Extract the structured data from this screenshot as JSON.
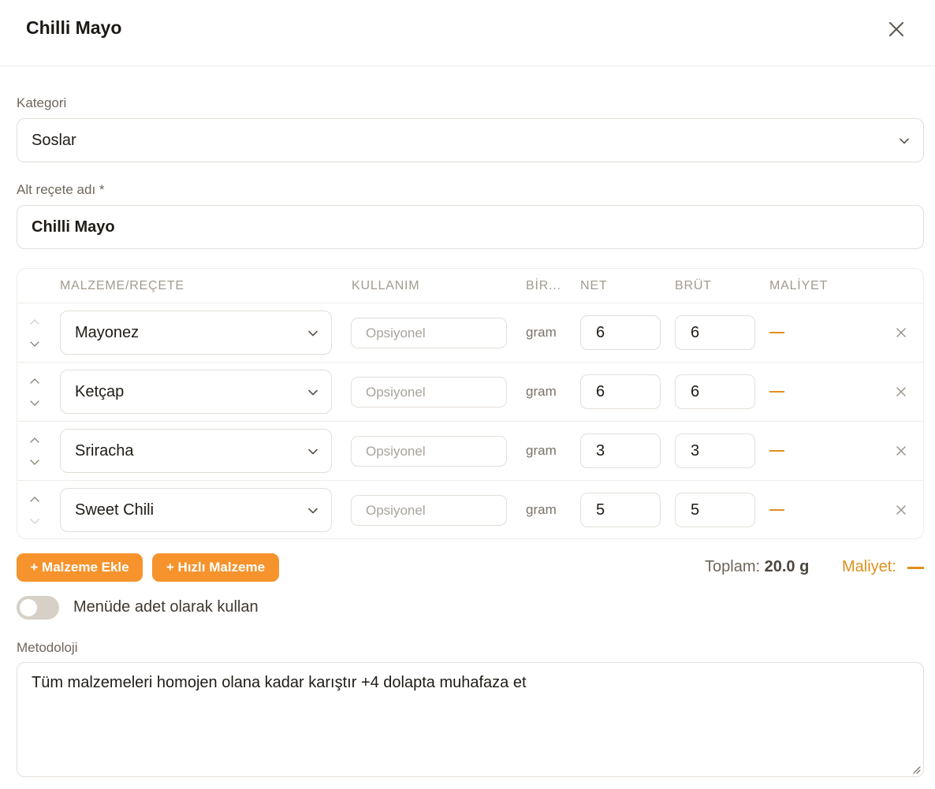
{
  "dialog": {
    "title": "Chilli Mayo"
  },
  "form": {
    "category": {
      "label": "Kategori",
      "value": "Soslar"
    },
    "name": {
      "label": "Alt reçete adı *",
      "value": "Chilli Mayo"
    }
  },
  "table": {
    "headers": {
      "ingredient": "MALZEME/REÇETE",
      "usage": "KULLANIM",
      "unit": "BİR...",
      "net": "NET",
      "gross": "BRÜT",
      "cost": "MALİYET"
    },
    "rows": [
      {
        "ingredient": "Mayonez",
        "usage_placeholder": "Opsiyonel",
        "unit": "gram",
        "net": "6",
        "gross": "6"
      },
      {
        "ingredient": "Ketçap",
        "usage_placeholder": "Opsiyonel",
        "unit": "gram",
        "net": "6",
        "gross": "6"
      },
      {
        "ingredient": "Sriracha",
        "usage_placeholder": "Opsiyonel",
        "unit": "gram",
        "net": "3",
        "gross": "3"
      },
      {
        "ingredient": "Sweet Chili",
        "usage_placeholder": "Opsiyonel",
        "unit": "gram",
        "net": "5",
        "gross": "5"
      }
    ]
  },
  "actions": {
    "add_ingredient": "+ Malzeme Ekle",
    "quick_ingredient": "+ Hızlı Malzeme"
  },
  "summary": {
    "total_label": "Toplam:",
    "total_value": "20.0 g",
    "cost_label": "Maliyet:"
  },
  "toggle": {
    "label": "Menüde adet olarak kullan",
    "checked": false
  },
  "methodology": {
    "label": "Metodoloji",
    "value": "Tüm malzemeleri homojen olana kadar karıştır +4 dolapta muhafaza et"
  },
  "colors": {
    "accent": "#f6932c",
    "cost_dash": "#e0901d"
  }
}
